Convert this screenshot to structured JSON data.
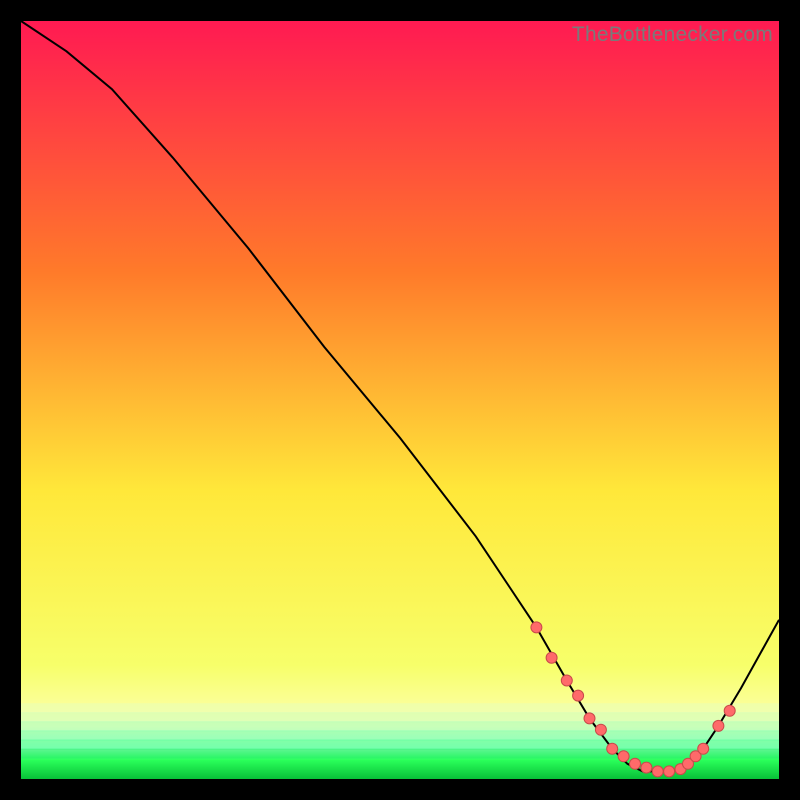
{
  "watermark": "TheBottlenecker.com",
  "colors": {
    "gradient_top": "#ff1a52",
    "gradient_mid1": "#ff7a2a",
    "gradient_mid2": "#ffe83a",
    "gradient_mid3": "#f7ff6a",
    "gradient_bottom_yellow": "#fdffb0",
    "gradient_green_band": "#2aff5a",
    "curve": "#000000",
    "dot_fill": "#ff6a6a",
    "dot_stroke": "#c94a4a"
  },
  "chart_data": {
    "type": "line",
    "title": "",
    "xlabel": "",
    "ylabel": "",
    "xlim": [
      0,
      100
    ],
    "ylim": [
      0,
      100
    ],
    "series": [
      {
        "name": "bottleneck-curve",
        "x": [
          0,
          6,
          12,
          20,
          30,
          40,
          50,
          60,
          68,
          72,
          75,
          78,
          80,
          82,
          84,
          86,
          88,
          90,
          92,
          95,
          100
        ],
        "y": [
          100,
          96,
          91,
          82,
          70,
          57,
          45,
          32,
          20,
          13,
          8,
          4,
          2,
          1,
          1,
          1,
          2,
          4,
          7,
          12,
          21
        ]
      }
    ],
    "highlight_points": {
      "name": "optimal-range-dots",
      "x": [
        68,
        70,
        72,
        73.5,
        75,
        76.5,
        78,
        79.5,
        81,
        82.5,
        84,
        85.5,
        87,
        88,
        89,
        90,
        92,
        93.5
      ],
      "y": [
        20,
        16,
        13,
        11,
        8,
        6.5,
        4,
        3,
        2,
        1.5,
        1,
        1,
        1.3,
        2,
        3,
        4,
        7,
        9
      ]
    }
  }
}
